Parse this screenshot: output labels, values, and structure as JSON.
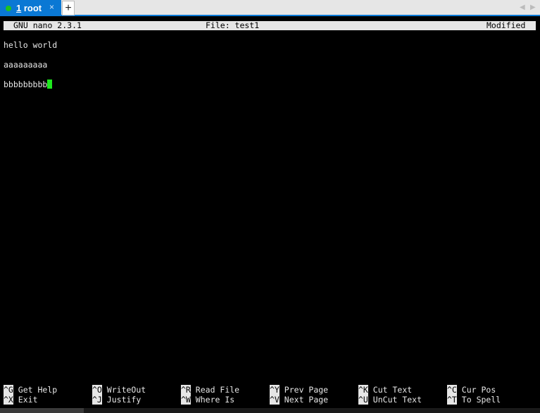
{
  "tab": {
    "number": "1",
    "label": " root",
    "close": "×",
    "status_color": "#1ec31e"
  },
  "new_tab": "+",
  "nav": {
    "left": "◀",
    "right": "▶"
  },
  "nano": {
    "version": "GNU nano 2.3.1",
    "file": "File: test1",
    "state": "Modified"
  },
  "lines": [
    "hello world",
    "",
    "aaaaaaaaa",
    "",
    "bbbbbbbbb"
  ],
  "shortcuts": [
    [
      {
        "key": "^G",
        "label": "Get Help"
      },
      {
        "key": "^X",
        "label": "Exit"
      }
    ],
    [
      {
        "key": "^O",
        "label": "WriteOut"
      },
      {
        "key": "^J",
        "label": "Justify"
      }
    ],
    [
      {
        "key": "^R",
        "label": "Read File"
      },
      {
        "key": "^W",
        "label": "Where Is"
      }
    ],
    [
      {
        "key": "^Y",
        "label": "Prev Page"
      },
      {
        "key": "^V",
        "label": "Next Page"
      }
    ],
    [
      {
        "key": "^K",
        "label": "Cut Text"
      },
      {
        "key": "^U",
        "label": "UnCut Text"
      }
    ],
    [
      {
        "key": "^C",
        "label": "Cur Pos"
      },
      {
        "key": "^T",
        "label": "To Spell"
      }
    ]
  ],
  "colors": {
    "accent": "#0a78d4",
    "cursor": "#1ee81e"
  }
}
